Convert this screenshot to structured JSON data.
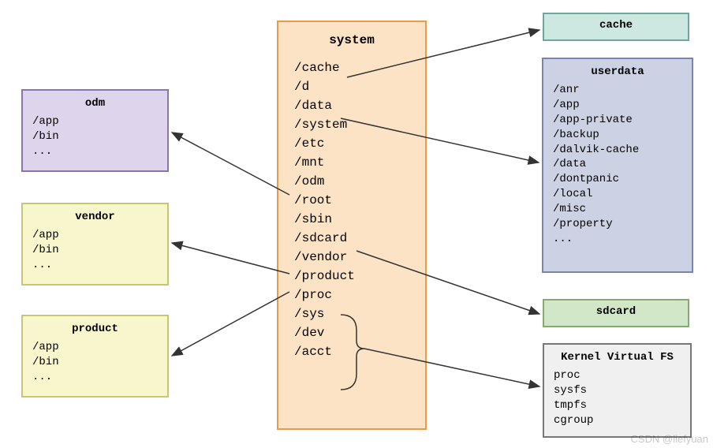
{
  "system": {
    "title": "system",
    "items": [
      "/cache",
      "/d",
      "/data",
      "/system",
      "/etc",
      "/mnt",
      "/odm",
      "/root",
      "/sbin",
      "/sdcard",
      "/vendor",
      "/product",
      "/proc",
      "/sys",
      "/dev",
      "/acct"
    ]
  },
  "odm": {
    "title": "odm",
    "items": [
      "/app",
      "/bin",
      "..."
    ]
  },
  "vendor": {
    "title": "vendor",
    "items": [
      "/app",
      "/bin",
      "..."
    ]
  },
  "product": {
    "title": "product",
    "items": [
      "/app",
      "/bin",
      "..."
    ]
  },
  "cache": {
    "title": "cache"
  },
  "userdata": {
    "title": "userdata",
    "items": [
      "/anr",
      "/app",
      "/app-private",
      "/backup",
      "/dalvik-cache",
      "/data",
      "/dontpanic",
      "/local",
      "/misc",
      "/property",
      "..."
    ]
  },
  "sdcard": {
    "title": "sdcard"
  },
  "kvfs": {
    "title": "Kernel Virtual FS",
    "items": [
      "proc",
      "sysfs",
      "tmpfs",
      "cgroup"
    ]
  },
  "watermark": "CSDN @liefyuan"
}
